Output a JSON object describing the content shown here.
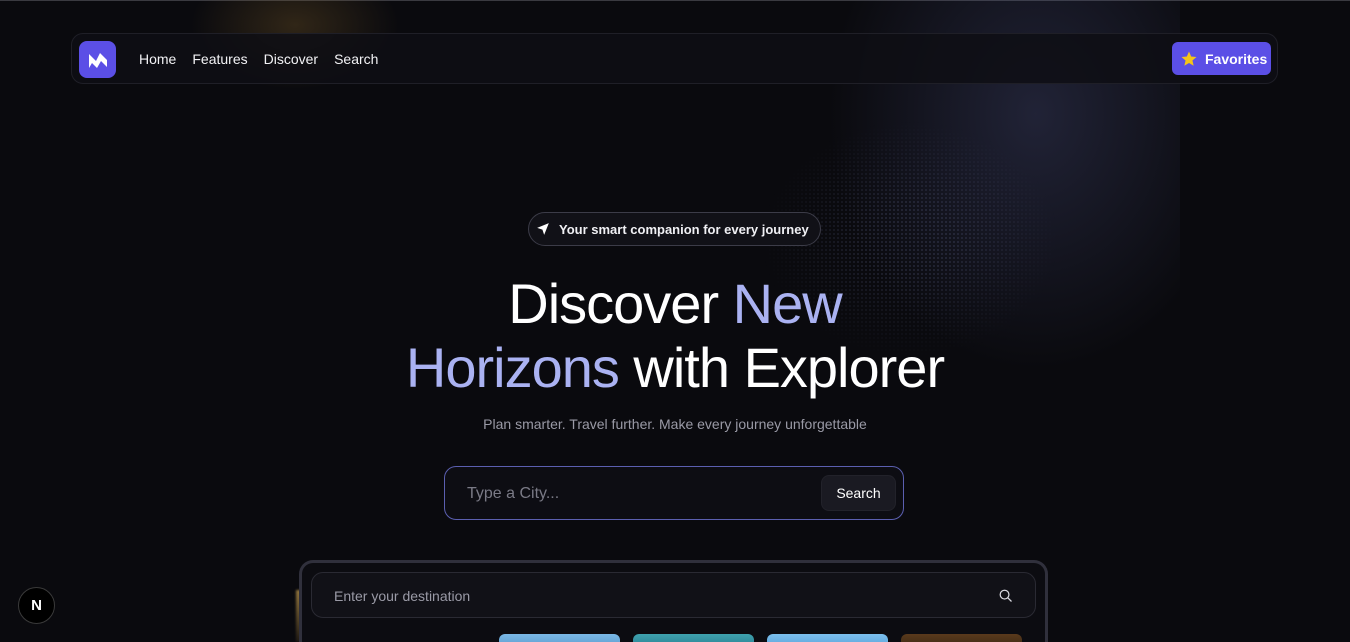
{
  "nav": {
    "logo_icon": "brand-logo-icon",
    "links": [
      "Home",
      "Features",
      "Discover",
      "Search"
    ],
    "favorites_label": "Favorites",
    "favorites_icon": "star-icon",
    "accent_color": "#5b4fe6"
  },
  "hero": {
    "badge_text": "Your smart companion for every journey",
    "badge_icon": "navigation-arrow-icon",
    "headline_part1": "Discover ",
    "headline_accent1": "New",
    "headline_accent2": "Horizons",
    "headline_part2": " with Explorer",
    "accent_color": "#aab2f2",
    "subtitle": "Plan smarter. Travel further. Make every journey unforgettable"
  },
  "search": {
    "placeholder": "Type a City...",
    "button_label": "Search"
  },
  "destination": {
    "placeholder": "Enter your destination",
    "icon": "search-icon"
  },
  "overlay": {
    "badge_letter": "N"
  }
}
